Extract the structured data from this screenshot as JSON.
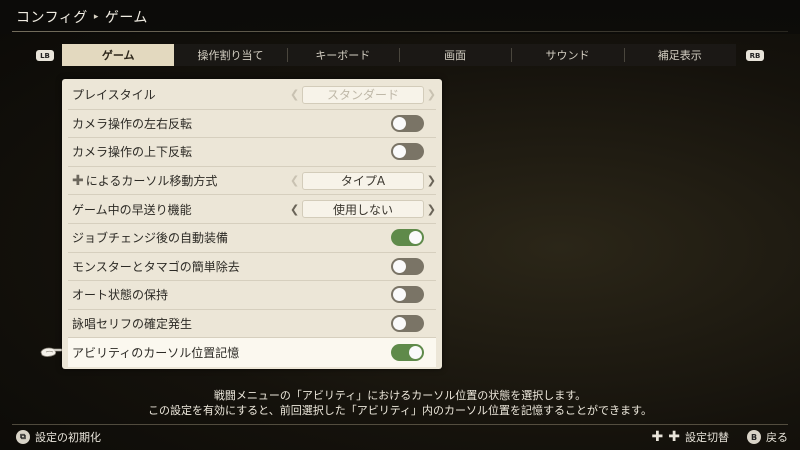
{
  "breadcrumb": {
    "root": "コンフィグ",
    "separator": "▸",
    "current": "ゲーム"
  },
  "tabs": {
    "lb": "LB",
    "rb": "RB",
    "items": [
      {
        "label": "ゲーム"
      },
      {
        "label": "操作割り当て"
      },
      {
        "label": "キーボード"
      },
      {
        "label": "画面"
      },
      {
        "label": "サウンド"
      },
      {
        "label": "補足表示"
      }
    ],
    "active_index": 0
  },
  "settings": [
    {
      "label": "プレイスタイル",
      "type": "selector",
      "value": "スタンダード",
      "disabled": true
    },
    {
      "label": "カメラ操作の左右反転",
      "type": "toggle",
      "on": false
    },
    {
      "label": "カメラ操作の上下反転",
      "type": "toggle",
      "on": false
    },
    {
      "label": "によるカーソル移動方式",
      "icon": "dpad-icon",
      "type": "selector",
      "value": "タイプA",
      "disabled": false
    },
    {
      "label": "ゲーム中の早送り機能",
      "type": "selector",
      "value": "使用しない",
      "disabled": false
    },
    {
      "label": "ジョブチェンジ後の自動装備",
      "type": "toggle",
      "on": true
    },
    {
      "label": "モンスターとタマゴの簡単除去",
      "type": "toggle",
      "on": false
    },
    {
      "label": "オート状態の保持",
      "type": "toggle",
      "on": false
    },
    {
      "label": "詠唱セリフの確定発生",
      "type": "toggle",
      "on": false
    },
    {
      "label": "アビリティのカーソル位置記憶",
      "type": "toggle",
      "on": true,
      "selected": true
    }
  ],
  "description": {
    "line1": "戦闘メニューの「アビリティ」におけるカーソル位置の状態を選択します。",
    "line2": "この設定を有効にすると、前回選択した「アビリティ」内のカーソル位置を記憶することができます。"
  },
  "footer": {
    "reset_button_glyph": "⧉",
    "reset_label": "設定の初期化",
    "switch_label": "設定切替",
    "back_button_glyph": "B",
    "back_label": "戻る"
  },
  "colors": {
    "panel_bg": "#ece6d7",
    "tab_active_bg": "#e3d9bf",
    "toggle_on": "#5f8a4a",
    "toggle_off": "#7a7466"
  }
}
